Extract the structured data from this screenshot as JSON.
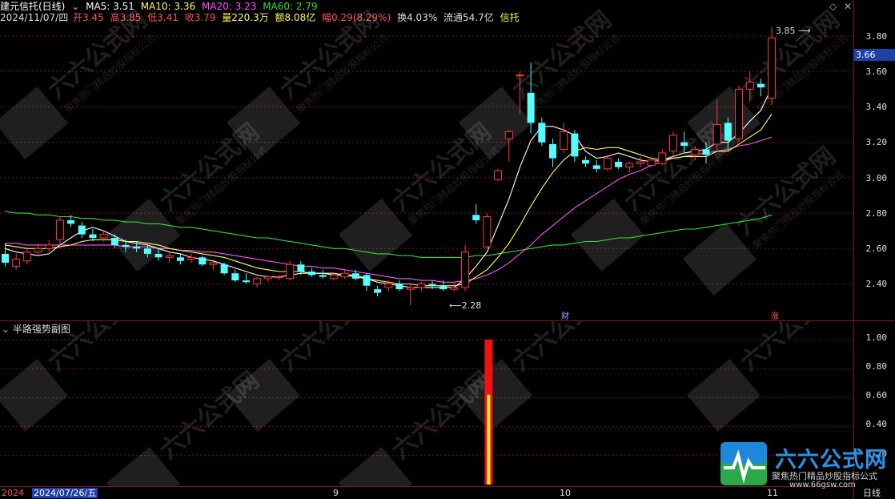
{
  "header": {
    "title": "建元信托(日线)",
    "ma5_label": "MA5: 3.51",
    "ma10_label": "MA10: 3.36",
    "ma20_label": "MA20: 3.23",
    "ma60_label": "MA60: 2.79",
    "date": "2024/11/07/四",
    "open": "开3.45",
    "high": "高3.85",
    "low": "低3.41",
    "close": "收3.79",
    "volume": "量220.3万",
    "amount": "额8.08亿",
    "change": "幅0.29(8.29%)",
    "turnover": "换4.03%",
    "float": "流通54.7亿",
    "sector": "信托"
  },
  "price_axis": [
    "3.80",
    "3.60",
    "3.40",
    "3.20",
    "3.00",
    "2.80",
    "2.60",
    "2.40"
  ],
  "current_price": "3.66",
  "max_label": "3.85",
  "min_label": "2.28",
  "tag_cai": "财",
  "tag_zhang": "涨",
  "sub_panel": {
    "title": "半路强势副图",
    "axis": [
      "1.00",
      "0.80",
      "0.60",
      "0.40",
      "0.20"
    ]
  },
  "dates": {
    "d0": "2024",
    "d1": "2024/07/26/五",
    "d2": "9",
    "d3": "10",
    "d4": "11",
    "period": "日线"
  },
  "watermark": {
    "brand": "六六公式网",
    "slogan": "聚焦热门精品炒股指标公式",
    "url": "www.66gsw.com"
  },
  "colors": {
    "up": "#ff3b3b",
    "down": "#54ffff",
    "ma5": "#ffffff",
    "ma10": "#ffff55",
    "ma20": "#ff55ff",
    "ma60": "#33dd33",
    "grid": "#7a1010"
  },
  "chart_data": {
    "type": "candlestick",
    "ylim": [
      2.25,
      3.88
    ],
    "ohlc": [
      [
        2.57,
        2.63,
        2.5,
        2.52
      ],
      [
        2.5,
        2.57,
        2.48,
        2.54
      ],
      [
        2.53,
        2.6,
        2.51,
        2.58
      ],
      [
        2.58,
        2.63,
        2.56,
        2.6
      ],
      [
        2.6,
        2.65,
        2.58,
        2.62
      ],
      [
        2.65,
        2.78,
        2.6,
        2.76
      ],
      [
        2.76,
        2.79,
        2.72,
        2.74
      ],
      [
        2.73,
        2.75,
        2.66,
        2.68
      ],
      [
        2.68,
        2.71,
        2.64,
        2.66
      ],
      [
        2.66,
        2.7,
        2.64,
        2.68
      ],
      [
        2.66,
        2.68,
        2.6,
        2.62
      ],
      [
        2.62,
        2.65,
        2.58,
        2.61
      ],
      [
        2.61,
        2.64,
        2.58,
        2.6
      ],
      [
        2.6,
        2.62,
        2.55,
        2.57
      ],
      [
        2.57,
        2.6,
        2.53,
        2.55
      ],
      [
        2.55,
        2.58,
        2.52,
        2.56
      ],
      [
        2.55,
        2.57,
        2.51,
        2.53
      ],
      [
        2.54,
        2.57,
        2.52,
        2.55
      ],
      [
        2.55,
        2.56,
        2.5,
        2.51
      ],
      [
        2.51,
        2.54,
        2.48,
        2.52
      ],
      [
        2.51,
        2.52,
        2.45,
        2.46
      ],
      [
        2.46,
        2.48,
        2.41,
        2.42
      ],
      [
        2.42,
        2.46,
        2.4,
        2.41
      ],
      [
        2.4,
        2.44,
        2.38,
        2.43
      ],
      [
        2.43,
        2.45,
        2.41,
        2.44
      ],
      [
        2.44,
        2.45,
        2.42,
        2.44
      ],
      [
        2.43,
        2.53,
        2.42,
        2.51
      ],
      [
        2.51,
        2.53,
        2.45,
        2.47
      ],
      [
        2.47,
        2.49,
        2.44,
        2.45
      ],
      [
        2.45,
        2.48,
        2.43,
        2.44
      ],
      [
        2.43,
        2.46,
        2.42,
        2.45
      ],
      [
        2.44,
        2.48,
        2.43,
        2.46
      ],
      [
        2.46,
        2.48,
        2.42,
        2.43
      ],
      [
        2.45,
        2.46,
        2.36,
        2.39
      ],
      [
        2.37,
        2.39,
        2.33,
        2.35
      ],
      [
        2.38,
        2.42,
        2.36,
        2.4
      ],
      [
        2.4,
        2.42,
        2.36,
        2.37
      ],
      [
        2.37,
        2.4,
        2.28,
        2.38
      ],
      [
        2.38,
        2.41,
        2.36,
        2.4
      ],
      [
        2.4,
        2.42,
        2.37,
        2.39
      ],
      [
        2.39,
        2.42,
        2.36,
        2.37
      ],
      [
        2.37,
        2.41,
        2.36,
        2.38
      ],
      [
        2.38,
        2.62,
        2.36,
        2.58
      ],
      [
        2.79,
        2.85,
        2.74,
        2.76
      ],
      [
        2.61,
        2.8,
        2.6,
        2.78
      ],
      [
        2.99,
        3.05,
        2.98,
        3.04
      ],
      [
        3.22,
        3.27,
        3.09,
        3.26
      ],
      [
        3.58,
        3.6,
        3.36,
        3.58
      ],
      [
        3.48,
        3.65,
        3.25,
        3.31
      ],
      [
        3.31,
        3.34,
        3.18,
        3.2
      ],
      [
        3.19,
        3.22,
        3.06,
        3.11
      ],
      [
        3.16,
        3.31,
        3.14,
        3.26
      ],
      [
        3.25,
        3.27,
        3.09,
        3.12
      ],
      [
        3.1,
        3.12,
        3.06,
        3.08
      ],
      [
        3.07,
        3.1,
        3.03,
        3.05
      ],
      [
        3.05,
        3.13,
        3.04,
        3.11
      ],
      [
        3.09,
        3.11,
        3.05,
        3.06
      ],
      [
        3.06,
        3.09,
        3.03,
        3.08
      ],
      [
        3.08,
        3.12,
        3.06,
        3.09
      ],
      [
        3.07,
        3.12,
        3.06,
        3.1
      ],
      [
        3.08,
        3.16,
        3.07,
        3.14
      ],
      [
        3.15,
        3.26,
        3.12,
        3.24
      ],
      [
        3.2,
        3.26,
        3.14,
        3.18
      ],
      [
        3.13,
        3.18,
        3.1,
        3.16
      ],
      [
        3.16,
        3.2,
        3.08,
        3.13
      ],
      [
        3.19,
        3.44,
        3.16,
        3.3
      ],
      [
        3.31,
        3.34,
        3.16,
        3.21
      ],
      [
        3.22,
        3.52,
        3.2,
        3.5
      ],
      [
        3.5,
        3.6,
        3.43,
        3.54
      ],
      [
        3.53,
        3.56,
        3.46,
        3.51
      ],
      [
        3.45,
        3.85,
        3.41,
        3.79
      ]
    ],
    "ma5": [
      2.6,
      2.58,
      2.57,
      2.56,
      2.57,
      2.62,
      2.66,
      2.7,
      2.72,
      2.7,
      2.67,
      2.64,
      2.63,
      2.62,
      2.6,
      2.58,
      2.57,
      2.55,
      2.54,
      2.53,
      2.51,
      2.49,
      2.47,
      2.45,
      2.44,
      2.44,
      2.45,
      2.46,
      2.46,
      2.46,
      2.46,
      2.45,
      2.45,
      2.43,
      2.41,
      2.4,
      2.39,
      2.38,
      2.38,
      2.38,
      2.38,
      2.38,
      2.43,
      2.5,
      2.58,
      2.73,
      2.88,
      3.06,
      3.21,
      3.29,
      3.29,
      3.27,
      3.24,
      3.15,
      3.11,
      3.12,
      3.14,
      3.12,
      3.1,
      3.09,
      3.1,
      3.12,
      3.14,
      3.15,
      3.16,
      3.2,
      3.2,
      3.25,
      3.32,
      3.38,
      3.51
    ],
    "ma10": [
      2.62,
      2.61,
      2.6,
      2.6,
      2.6,
      2.61,
      2.62,
      2.64,
      2.65,
      2.65,
      2.65,
      2.64,
      2.64,
      2.63,
      2.62,
      2.6,
      2.59,
      2.58,
      2.57,
      2.56,
      2.55,
      2.53,
      2.51,
      2.49,
      2.48,
      2.47,
      2.47,
      2.47,
      2.46,
      2.46,
      2.45,
      2.45,
      2.44,
      2.43,
      2.42,
      2.41,
      2.4,
      2.4,
      2.39,
      2.39,
      2.39,
      2.39,
      2.4,
      2.44,
      2.48,
      2.55,
      2.63,
      2.73,
      2.84,
      2.94,
      3.03,
      3.1,
      3.15,
      3.17,
      3.16,
      3.17,
      3.17,
      3.15,
      3.13,
      3.11,
      3.1,
      3.11,
      3.12,
      3.12,
      3.12,
      3.15,
      3.15,
      3.19,
      3.23,
      3.27,
      3.36
    ],
    "ma20": [
      2.63,
      2.63,
      2.62,
      2.62,
      2.62,
      2.62,
      2.62,
      2.62,
      2.62,
      2.62,
      2.62,
      2.61,
      2.61,
      2.61,
      2.6,
      2.6,
      2.59,
      2.59,
      2.58,
      2.58,
      2.57,
      2.56,
      2.55,
      2.54,
      2.53,
      2.52,
      2.51,
      2.5,
      2.5,
      2.49,
      2.49,
      2.48,
      2.47,
      2.46,
      2.45,
      2.44,
      2.43,
      2.43,
      2.42,
      2.42,
      2.41,
      2.41,
      2.42,
      2.43,
      2.45,
      2.48,
      2.52,
      2.57,
      2.62,
      2.68,
      2.73,
      2.78,
      2.83,
      2.87,
      2.91,
      2.95,
      2.99,
      3.02,
      3.04,
      3.07,
      3.09,
      3.11,
      3.12,
      3.13,
      3.14,
      3.15,
      3.16,
      3.18,
      3.19,
      3.21,
      3.23
    ],
    "ma60": [
      2.81,
      2.8,
      2.8,
      2.79,
      2.79,
      2.78,
      2.78,
      2.77,
      2.77,
      2.76,
      2.76,
      2.75,
      2.75,
      2.74,
      2.74,
      2.73,
      2.72,
      2.72,
      2.71,
      2.7,
      2.69,
      2.68,
      2.67,
      2.66,
      2.66,
      2.65,
      2.64,
      2.63,
      2.62,
      2.61,
      2.6,
      2.6,
      2.59,
      2.58,
      2.57,
      2.57,
      2.56,
      2.56,
      2.55,
      2.55,
      2.55,
      2.55,
      2.55,
      2.56,
      2.56,
      2.57,
      2.58,
      2.59,
      2.6,
      2.61,
      2.62,
      2.62,
      2.63,
      2.64,
      2.64,
      2.65,
      2.66,
      2.66,
      2.67,
      2.68,
      2.69,
      2.7,
      2.71,
      2.71,
      2.72,
      2.73,
      2.74,
      2.75,
      2.76,
      2.77,
      2.79
    ],
    "sub_bar": {
      "index": 44,
      "red_top": 1.0,
      "yellow_top": 0.62
    },
    "sub_ylim": [
      0,
      1.05
    ]
  }
}
